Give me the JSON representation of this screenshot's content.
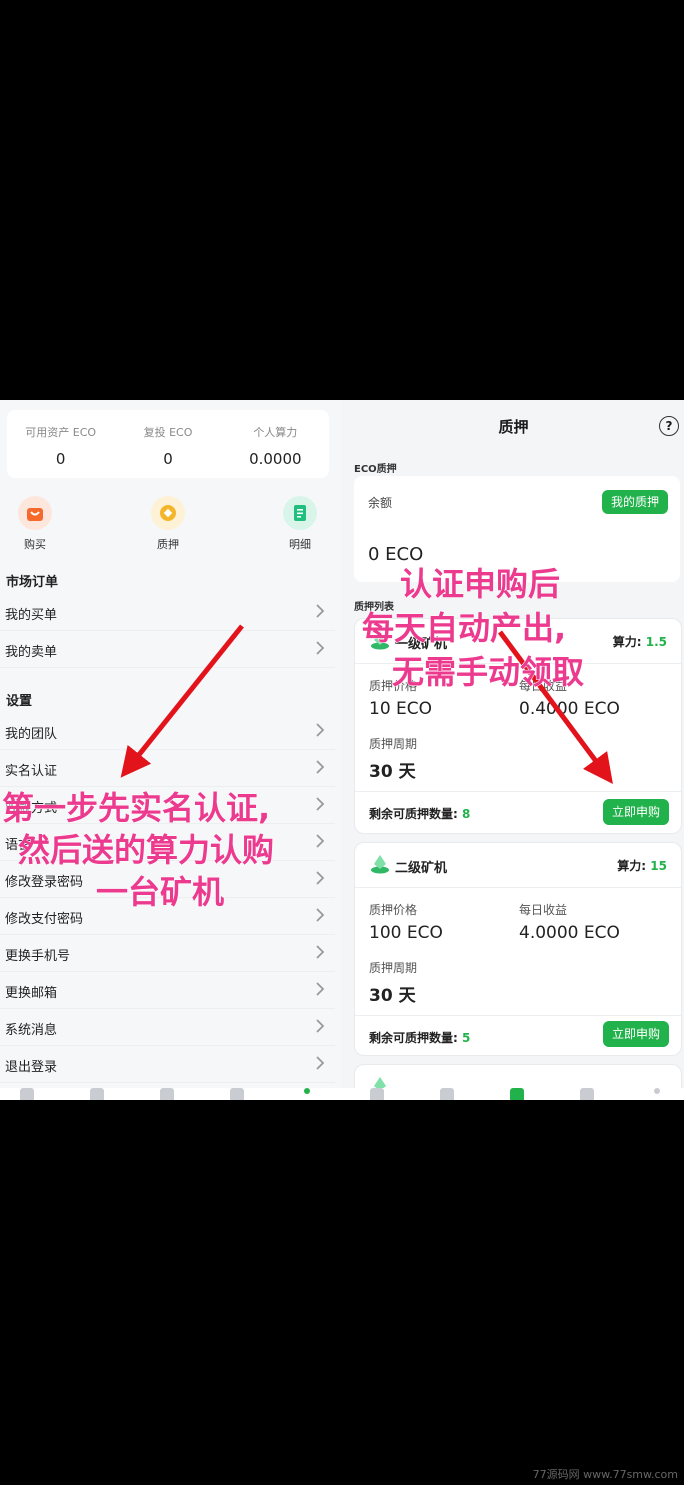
{
  "left": {
    "stats": [
      {
        "label": "可用资产 ECO",
        "value": "0"
      },
      {
        "label": "复投 ECO",
        "value": "0"
      },
      {
        "label": "个人算力",
        "value": "0.0000"
      }
    ],
    "quick": [
      {
        "label": "购买",
        "icon": "shopping-bag-icon"
      },
      {
        "label": "质押",
        "icon": "coin-icon"
      },
      {
        "label": "明细",
        "icon": "document-icon"
      }
    ],
    "market_title": "市场订单",
    "market_items": [
      "我的买单",
      "我的卖单"
    ],
    "settings_title": "设置",
    "settings_items": [
      "我的团队",
      "实名认证",
      "收款方式",
      "语言",
      "修改登录密码",
      "修改支付密码",
      "更换手机号",
      "更换邮箱",
      "系统消息",
      "退出登录"
    ]
  },
  "right": {
    "title": "质押",
    "eco_label": "ECO质押",
    "balance_label": "余额",
    "my_stake_btn": "我的质押",
    "balance_value": "0 ECO",
    "list_label": "质押列表",
    "cards": [
      {
        "name": "一级矿机",
        "hash_label": "算力:",
        "hash": "1.5",
        "price_label": "质押价格",
        "price": "10 ECO",
        "daily_label": "每日收益",
        "daily": "0.4000 ECO",
        "period_label": "质押周期",
        "period": "30 天",
        "remain_label": "剩余可质押数量:",
        "remain": "8",
        "buy": "立即申购"
      },
      {
        "name": "二级矿机",
        "hash_label": "算力:",
        "hash": "15",
        "price_label": "质押价格",
        "price": "100 ECO",
        "daily_label": "每日收益",
        "daily": "4.0000 ECO",
        "period_label": "质押周期",
        "period": "30 天",
        "remain_label": "剩余可质押数量:",
        "remain": "5",
        "buy": "立即申购"
      }
    ]
  },
  "annotations": {
    "left": [
      "第一步先实名认证,",
      "然后送的算力认购",
      "一台矿机"
    ],
    "right": [
      "认证申购后",
      "每天自动产出,",
      "无需手动领取"
    ]
  },
  "colors": {
    "accent": "#22b24c",
    "annotation": "#ec3a8f",
    "arrow": "#e3131b"
  },
  "watermark": "77源码网 www.77smw.com"
}
